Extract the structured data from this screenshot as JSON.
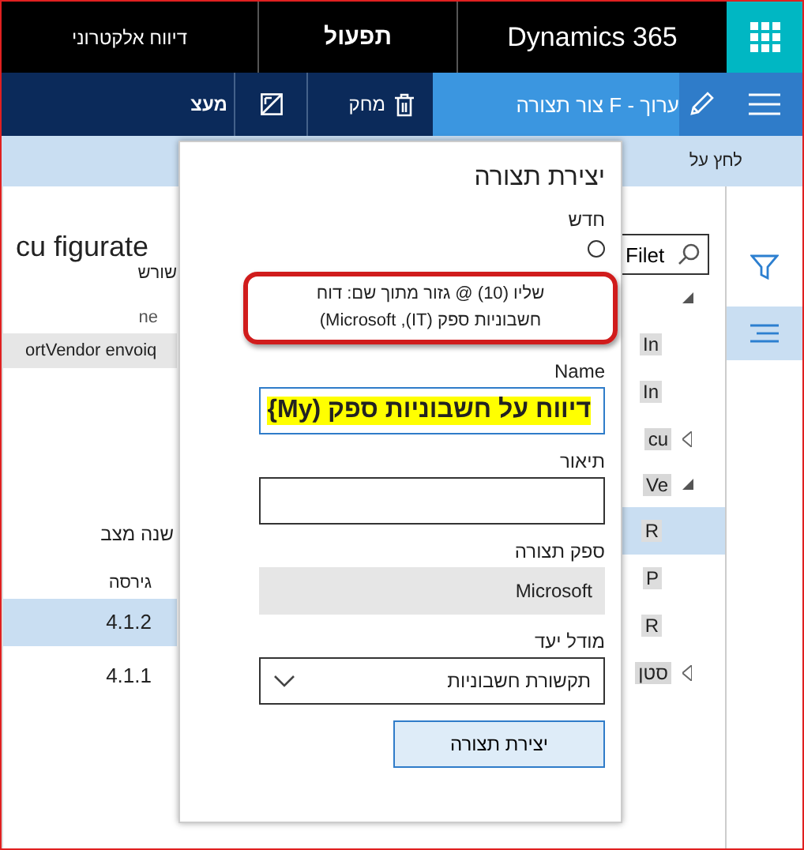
{
  "header": {
    "page_title": "דיווח אלקטרוני",
    "module": "תפעול",
    "app_name": "Dynamics 365"
  },
  "action_bar": {
    "items": [
      {
        "kind": "edit",
        "label": "ערוך - F צור תצורה",
        "selected": true
      },
      {
        "kind": "delete",
        "label": "מחק"
      },
      {
        "kind": "icon"
      },
      {
        "kind": "text",
        "label": "מעצ"
      }
    ]
  },
  "info_strip": {
    "text": "לחץ על"
  },
  "tree": {
    "search": {
      "value": "Filet"
    },
    "items": [
      {
        "expanded": true,
        "selected": false,
        "children": [
          {
            "label": "In",
            "selected": false
          },
          {
            "label": "In",
            "selected": false
          }
        ]
      },
      {
        "label": "cu",
        "expanded": false,
        "selected": false
      },
      {
        "label": "Ve",
        "expanded": true,
        "selected": false,
        "children": [
          {
            "label": "R",
            "selected": true
          },
          {
            "label": "P",
            "selected": false
          },
          {
            "label": "R",
            "selected": false
          }
        ]
      },
      {
        "label": "סטן",
        "expanded": false,
        "selected": false
      }
    ]
  },
  "details": {
    "title": "cu figurate",
    "root_label": "שורש",
    "column_fragment": "ne",
    "row_text": "ortVendor envoiq",
    "status_label": "שנה מצב",
    "version_header": "גירסה",
    "versions": [
      {
        "label": "4.1.2",
        "selected": true
      },
      {
        "label": "4.1.1",
        "selected": false
      }
    ]
  },
  "dialog": {
    "title": "יצירת תצורה",
    "new_label": "חדש",
    "option": {
      "selected": false
    },
    "derived": {
      "line1": "שליו (10) @ גזור מתוך שם: דוח",
      "line2": "חשבוניות ספק (IT), Microsoft)"
    },
    "name": {
      "label": "Name",
      "value": "דיווח על חשבוניות ספק (My}"
    },
    "description": {
      "label": "תיאור"
    },
    "provider": {
      "label": "ספק תצורה",
      "value": "Microsoft"
    },
    "target_model": {
      "label": "מודל יעד",
      "value": "תקשורת חשבוניות"
    },
    "create_button": "יצירת תצורה"
  }
}
